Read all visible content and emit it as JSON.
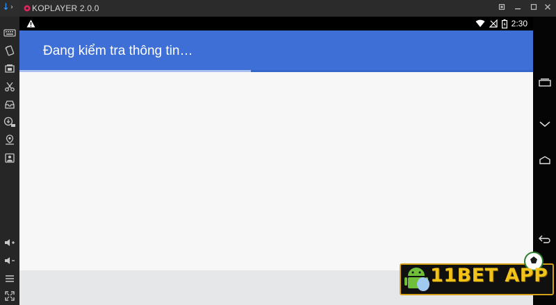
{
  "window": {
    "title": "KOPLAYER 2.0.0",
    "controls": [
      "restore",
      "minimize",
      "maximize",
      "close"
    ]
  },
  "sidebar": {
    "items": [
      {
        "icon": "keyboard-icon"
      },
      {
        "icon": "rotate-icon"
      },
      {
        "icon": "screenshot-icon"
      },
      {
        "icon": "scissors-icon"
      },
      {
        "icon": "inbox-icon"
      },
      {
        "icon": "apk-install-icon"
      },
      {
        "icon": "location-icon"
      },
      {
        "icon": "file-share-icon"
      },
      {
        "icon": "volume-up-icon"
      },
      {
        "icon": "volume-down-icon"
      },
      {
        "icon": "menu-icon"
      },
      {
        "icon": "fullscreen-icon"
      }
    ]
  },
  "statusbar": {
    "time": "2:30",
    "icons": [
      "warning-icon",
      "wifi-icon",
      "no-signal-icon",
      "battery-charging-icon"
    ]
  },
  "app": {
    "title": "Đang kiểm tra thông tin…",
    "progress": 0.45,
    "accent": "#3d6fd6"
  },
  "navbar": {
    "buttons": [
      "recent-apps",
      "back-chevron",
      "home",
      "back"
    ]
  },
  "watermark": {
    "text": "11BET APP"
  }
}
